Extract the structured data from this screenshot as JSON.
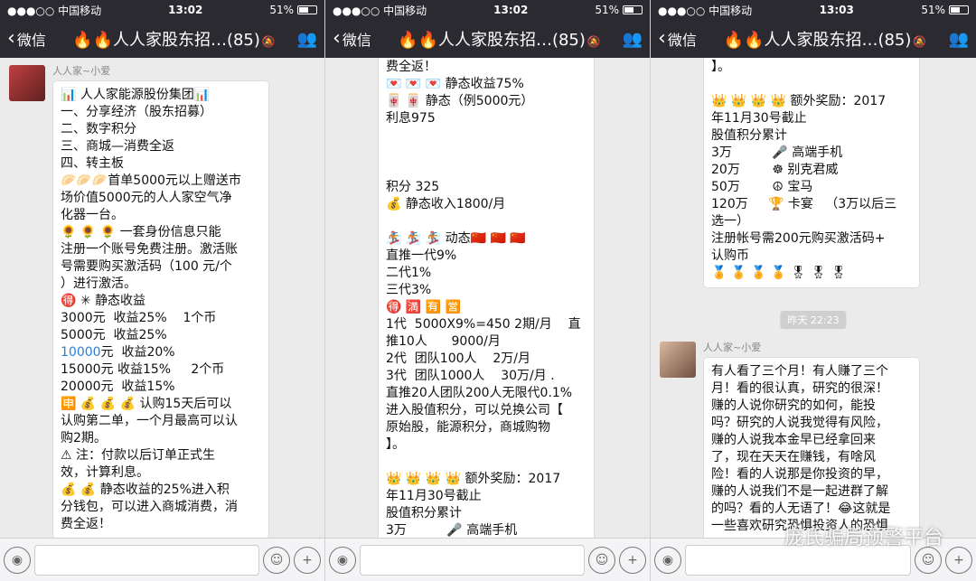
{
  "phones": [
    {
      "status": {
        "carrier": "●●●○○ 中国移动",
        "time": "13:02",
        "battery": "51%"
      },
      "nav": {
        "back": "微信",
        "title": "🔥🔥人人家股东招…(85)"
      },
      "messages": [
        {
          "sender": "人人家~小爱",
          "lines": [
            "📊 人人家能源股份集团📊",
            "一、分享经济（股东招募）",
            "二、数字积分",
            "三、商城—消费全返",
            "四、转主板",
            "🥟🥟🥟首单5000元以上赠送市",
            "场价值5000元的人人家空气净",
            "化器一台。",
            "🌻 🌻 🌻 一套身份信息只能",
            "注册一个账号免费注册。激活账",
            "号需要购买激活码（100 元/个",
            "）进行激活。",
            "🉐 ✳ 静态收益",
            "3000元  收益25%    1个币",
            "5000元  收益25%",
            "10000元  收益20%",
            "15000元 收益15%     2个币",
            "20000元  收益15%",
            "🈸 💰 💰 💰 认购15天后可以",
            "认购第二单，一个月最高可以认",
            "购2期。",
            "⚠ 注：付款以后订单正式生",
            "效，计算利息。",
            "💰 💰 静态收益的25%进入积",
            "分钱包，可以进入商城消费，消",
            "费全返！"
          ]
        }
      ]
    },
    {
      "status": {
        "carrier": "●●●○○ 中国移动",
        "time": "13:02",
        "battery": "51%"
      },
      "nav": {
        "back": "微信",
        "title": "🔥🔥人人家股东招…(85)"
      },
      "messages": [
        {
          "sender": "",
          "lines": [
            "费全返！",
            "💌 💌 💌 静态收益75%",
            "🀄 🀄 静态（例5000元）",
            "利息975",
            "",
            "",
            "",
            "积分 325",
            "💰 静态收入1800/月",
            "",
            "🏂 🏂 🏂 动态🇨🇳 🇨🇳 🇨🇳",
            "直推一代9%",
            "二代1%",
            "三代3%",
            "🉐 🈵 🈶 🈺",
            "1代  5000X9%=450 2期/月    直",
            "推10人      9000/月",
            "2代  团队100人    2万/月",
            "3代  团队1000人    30万/月 .",
            "直推20人团队200人无限代0.1%",
            "进入股值积分，可以兑换公司【",
            "原始股，能源积分，商城购物",
            "】。",
            "",
            "👑 👑 👑 👑 额外奖励：2017",
            "年11月30号截止",
            "股值积分累计",
            "3万          🎤 高端手机"
          ]
        }
      ]
    },
    {
      "status": {
        "carrier": "●●●○○ 中国移动",
        "time": "13:03",
        "battery": "51%"
      },
      "nav": {
        "back": "微信",
        "title": "🔥🔥人人家股东招…(85)"
      },
      "messages": [
        {
          "sender": "",
          "lines": [
            "】。",
            "",
            "👑 👑 👑 👑 额外奖励：2017",
            "年11月30号截止",
            "股值积分累计",
            "3万          🎤 高端手机",
            "20万        ☸ 别克君威",
            "50万        ☮ 宝马",
            "120万     🏆 卡宴   （3万以后三",
            "选一）",
            "注册帐号需200元购买激活码+",
            "认购币",
            "🏅 🏅 🏅 🏅 🎖 🎖 🎖"
          ]
        },
        {
          "sender": "人人家~小爱",
          "lines": [
            "有人看了三个月！有人赚了三个",
            "月！看的很认真，研究的很深！",
            "赚的人说你研究的如何，能投",
            "吗？研究的人说我觉得有风险，",
            "赚的人说我本金早已经拿回来",
            "了，现在天天在赚钱，有啥风",
            "险！看的人说那是你投资的早，",
            "赚的人说我们不是一起进群了解",
            "的吗？看的人无语了！😂这就是",
            "一些喜欢研究恐惧投资人的恐惧"
          ]
        }
      ],
      "timechip": "昨天 22:23"
    }
  ],
  "watermark": "庞氏骗局预警平台",
  "icons": {
    "voice": "voice-icon",
    "emoji": "emoji-icon",
    "plus": "plus-icon"
  }
}
